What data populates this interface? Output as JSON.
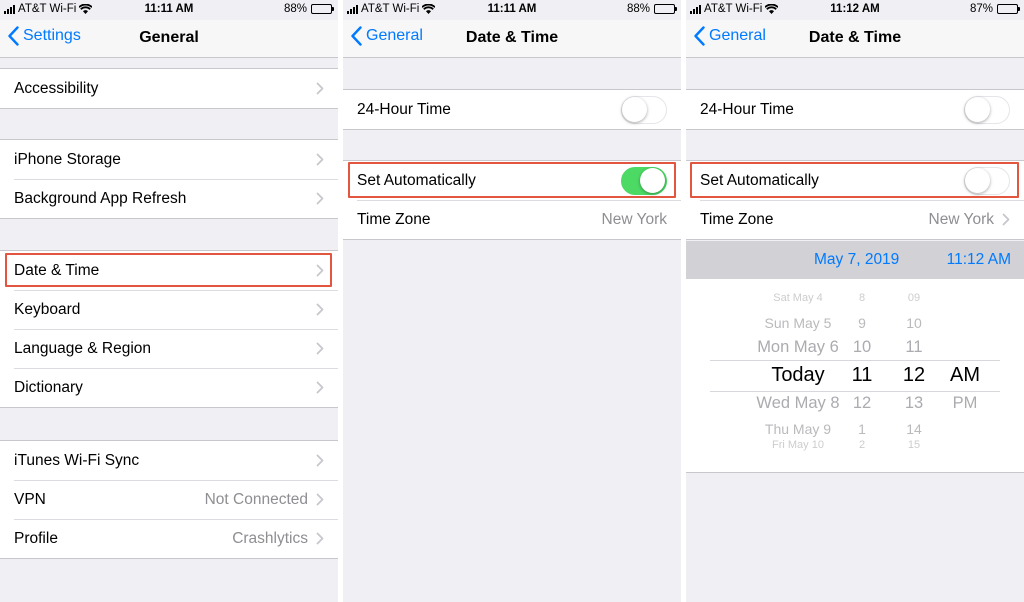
{
  "status": [
    {
      "carrier": "AT&T Wi-Fi",
      "time": "11:11 AM",
      "battery": "88%",
      "battery_level": 0.88
    },
    {
      "carrier": "AT&T Wi-Fi",
      "time": "11:11 AM",
      "battery": "88%",
      "battery_level": 0.88
    },
    {
      "carrier": "AT&T Wi-Fi",
      "time": "11:12 AM",
      "battery": "87%",
      "battery_level": 0.87
    }
  ],
  "screen1": {
    "back": "Settings",
    "title": "General",
    "groups": [
      [
        {
          "label": "Accessibility"
        }
      ],
      [
        {
          "label": "iPhone Storage"
        },
        {
          "label": "Background App Refresh"
        }
      ],
      [
        {
          "label": "Date & Time"
        },
        {
          "label": "Keyboard"
        },
        {
          "label": "Language & Region"
        },
        {
          "label": "Dictionary"
        }
      ],
      [
        {
          "label": "iTunes Wi-Fi Sync",
          "value": ""
        },
        {
          "label": "VPN",
          "value": "Not Connected"
        },
        {
          "label": "Profile",
          "value": "Crashlytics"
        }
      ]
    ]
  },
  "screen2": {
    "back": "General",
    "title": "Date & Time",
    "hour24": {
      "label": "24-Hour Time",
      "on": false
    },
    "auto": {
      "label": "Set Automatically",
      "on": true
    },
    "timezone": {
      "label": "Time Zone",
      "value": "New York"
    }
  },
  "screen3": {
    "back": "General",
    "title": "Date & Time",
    "hour24": {
      "label": "24-Hour Time",
      "on": false
    },
    "auto": {
      "label": "Set Automatically",
      "on": false
    },
    "timezone": {
      "label": "Time Zone",
      "value": "New York"
    },
    "selected_date": "May 7, 2019",
    "selected_time": "11:12 AM",
    "picker": {
      "days": [
        "Sat May 4",
        "Sun May 5",
        "Mon May 6",
        "Today",
        "Wed May 8",
        "Thu May 9",
        "Fri May 10"
      ],
      "hours": [
        "8",
        "9",
        "10",
        "11",
        "12",
        "1",
        "2"
      ],
      "minutes": [
        "09",
        "10",
        "11",
        "12",
        "13",
        "14",
        "15"
      ],
      "ampm": [
        "AM",
        "PM"
      ]
    }
  },
  "colors": {
    "accent": "#007aff",
    "toggle_on": "#4cd964",
    "highlight": "#e2553e",
    "value_gray": "#8e8e93"
  }
}
